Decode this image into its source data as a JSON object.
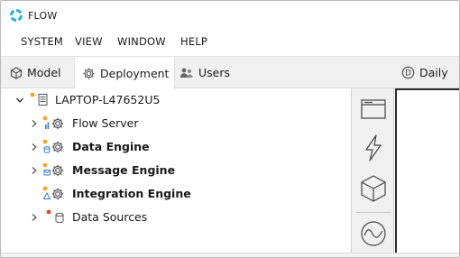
{
  "app": {
    "title": "FLOW",
    "accent": "#22b5c9"
  },
  "menu": {
    "items": [
      "SYSTEM",
      "VIEW",
      "WINDOW",
      "HELP"
    ]
  },
  "tabs": [
    {
      "label": "Model",
      "icon": "cube-icon"
    },
    {
      "label": "Deployment",
      "icon": "gear-icon"
    },
    {
      "label": "Users",
      "icon": "users-icon"
    }
  ],
  "schedule": {
    "label": "Daily",
    "icon": "d-circle-icon"
  },
  "tree": {
    "root": {
      "label": "LAPTOP-L47652U5",
      "icon": "server-icon",
      "status_color": "#f5a623"
    },
    "children": [
      {
        "label": "Flow Server",
        "icon": "gear-icon",
        "bold": false,
        "status_color": "#f5a623"
      },
      {
        "label": "Data Engine",
        "icon": "gear-icon",
        "bold": true,
        "status_color": "#f5a623"
      },
      {
        "label": "Message Engine",
        "icon": "gear-icon",
        "bold": true,
        "status_color": "#f5a623"
      },
      {
        "label": "Integration Engine",
        "icon": "gear-icon",
        "bold": true,
        "status_color": "#f5a623"
      },
      {
        "label": "Data Sources",
        "icon": "database-icon",
        "bold": false,
        "status_color": "#e8472b"
      }
    ]
  },
  "side_toolbar": {
    "buttons": [
      "window-icon",
      "lightning-icon",
      "cube-icon",
      "wave-icon"
    ]
  }
}
